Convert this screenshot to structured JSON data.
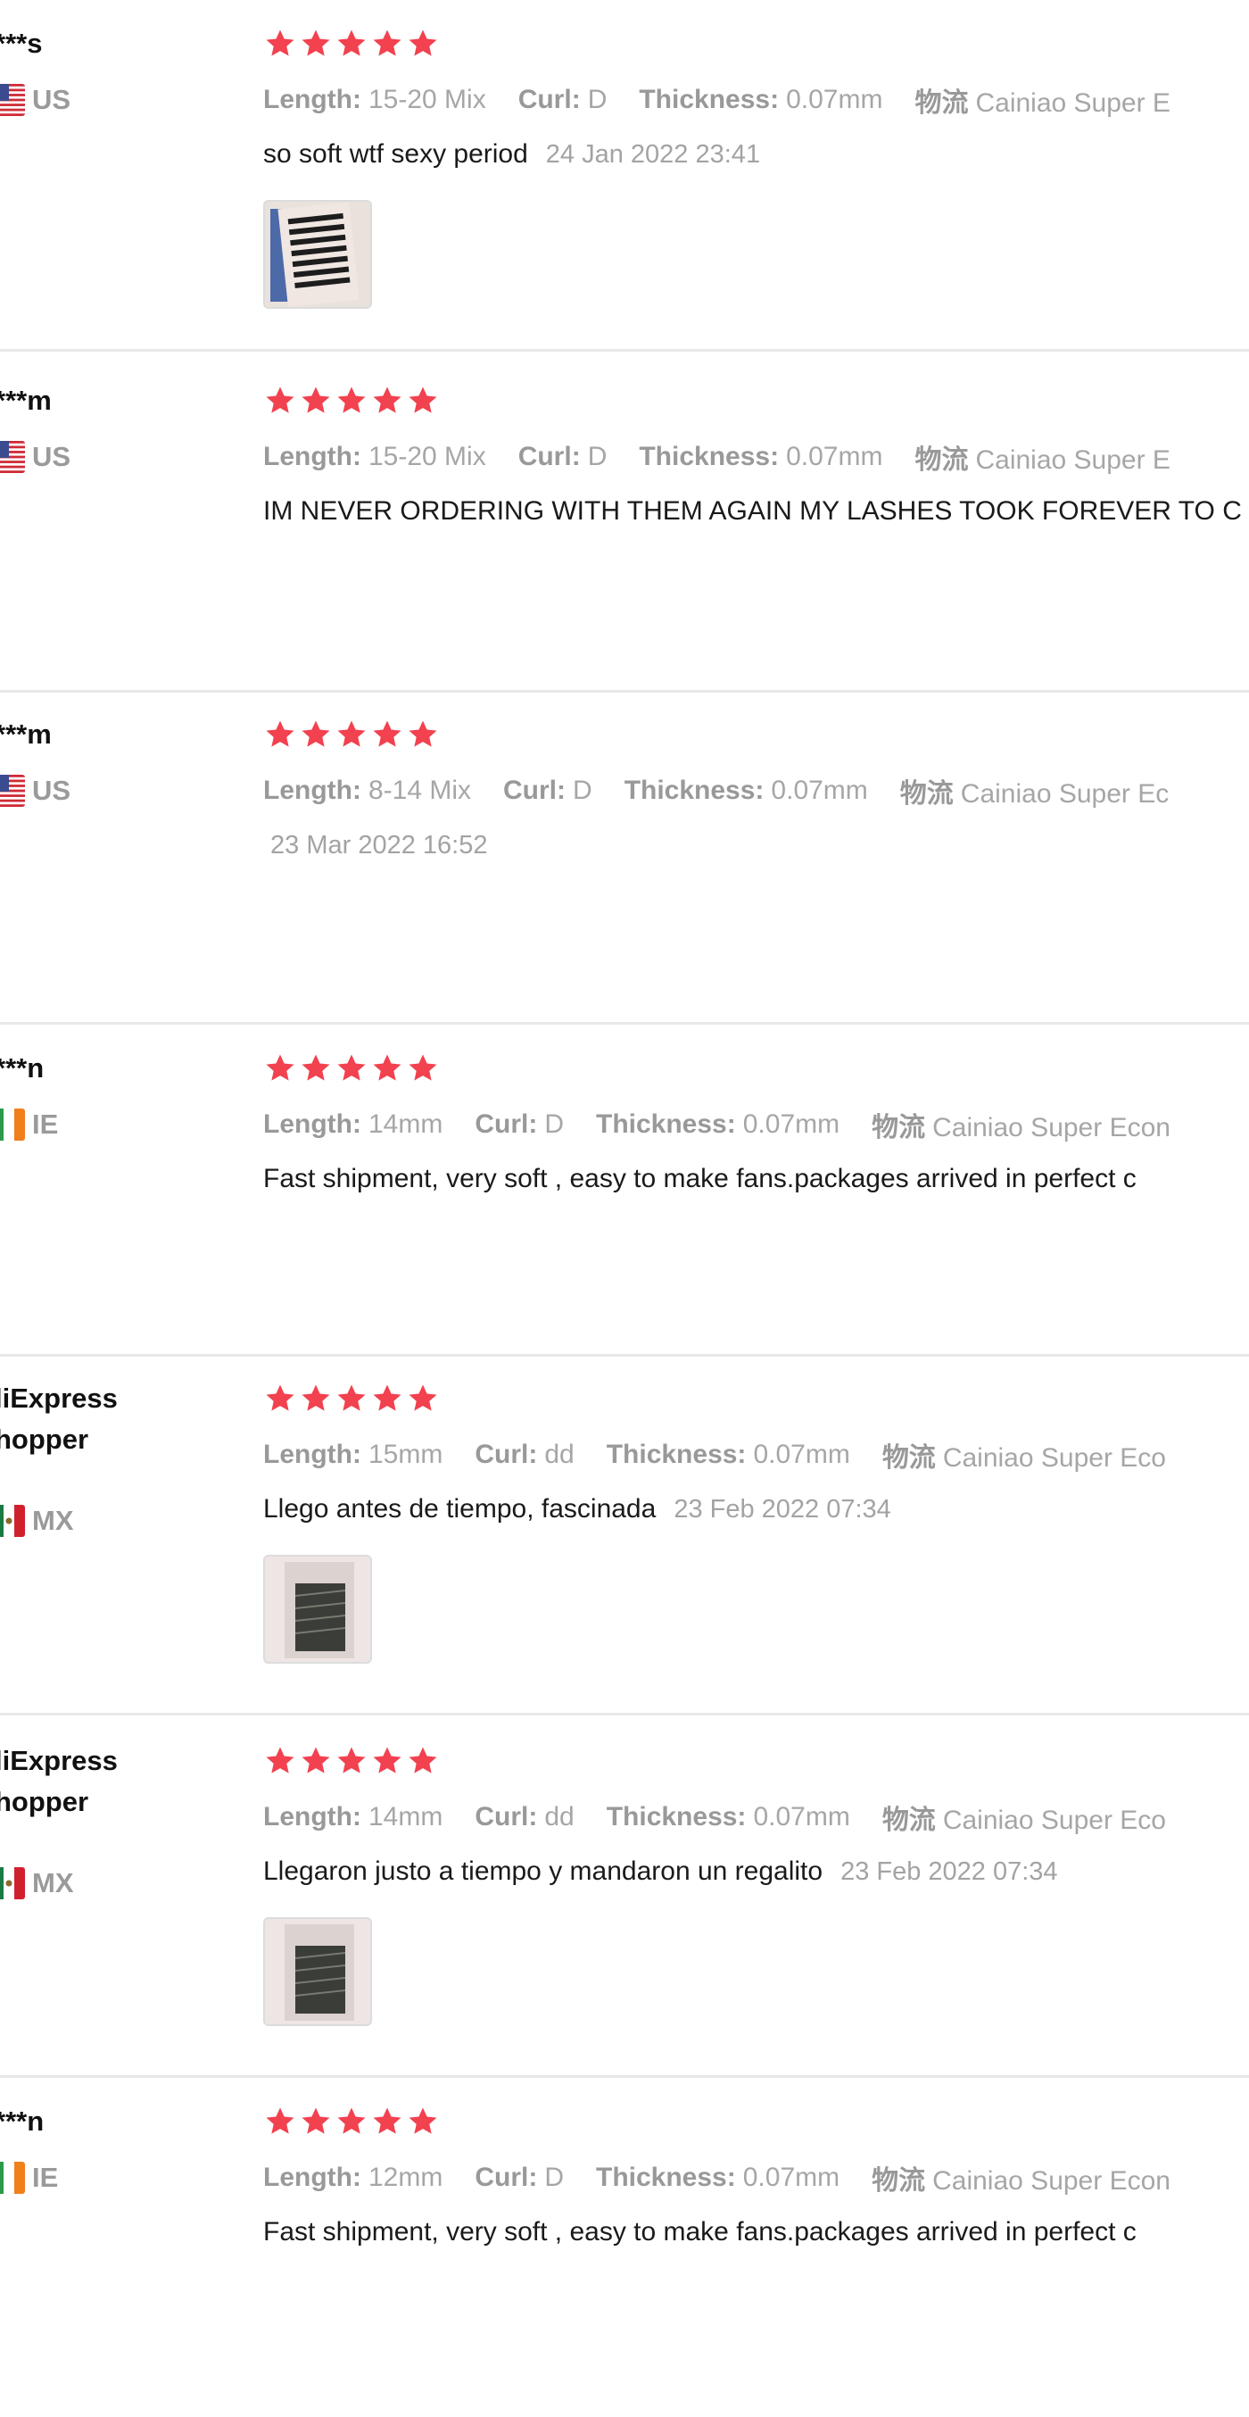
{
  "colors": {
    "star": "#f2414f",
    "attr_label": "#999999",
    "date": "#a3a3a3",
    "divider": "#e8e8e8",
    "text": "#1a1a1a"
  },
  "labels": {
    "length": "Length:",
    "curl": "Curl:",
    "thickness": "Thickness:",
    "shipping": "物流"
  },
  "reviews": [
    {
      "user": "***s",
      "country_code": "US",
      "flag": "us-flag-icon",
      "rating": 5,
      "length": "15-20 Mix",
      "curl": "D",
      "thickness": "0.07mm",
      "shipping": "Cainiao Super E",
      "comment": "so soft wtf sexy period",
      "date": "24 Jan 2022 23:41",
      "has_image": true
    },
    {
      "user": "***m",
      "country_code": "US",
      "flag": "us-flag-icon",
      "rating": 5,
      "length": "15-20 Mix",
      "curl": "D",
      "thickness": "0.07mm",
      "shipping": "Cainiao Super E",
      "comment": "IM NEVER ORDERING WITH THEM AGAIN MY LASHES TOOK FOREVER TO C",
      "date": "",
      "has_image": false
    },
    {
      "user": "***m",
      "country_code": "US",
      "flag": "us-flag-icon",
      "rating": 5,
      "length": "8-14 Mix",
      "curl": "D",
      "thickness": "0.07mm",
      "shipping": "Cainiao Super Ec",
      "comment": "",
      "date": "23 Mar 2022 16:52",
      "has_image": false
    },
    {
      "user": "***n",
      "country_code": "IE",
      "flag": "ie-flag-icon",
      "rating": 5,
      "length": "14mm",
      "curl": "D",
      "thickness": "0.07mm",
      "shipping": "Cainiao Super Econ",
      "comment": "Fast shipment, very soft , easy to make fans.packages arrived in perfect c",
      "date": "",
      "has_image": false
    },
    {
      "user": "liExpress\nhopper",
      "country_code": "MX",
      "flag": "mx-flag-icon",
      "rating": 5,
      "length": "15mm",
      "curl": "dd",
      "thickness": "0.07mm",
      "shipping": "Cainiao Super Eco",
      "comment": "Llego antes de tiempo, fascinada",
      "date": "23 Feb 2022 07:34",
      "has_image": true
    },
    {
      "user": "liExpress\nhopper",
      "country_code": "MX",
      "flag": "mx-flag-icon",
      "rating": 5,
      "length": "14mm",
      "curl": "dd",
      "thickness": "0.07mm",
      "shipping": "Cainiao Super Eco",
      "comment": "Llegaron justo a tiempo y mandaron un regalito",
      "date": "23 Feb 2022 07:34",
      "has_image": true
    },
    {
      "user": "***n",
      "country_code": "IE",
      "flag": "ie-flag-icon",
      "rating": 5,
      "length": "12mm",
      "curl": "D",
      "thickness": "0.07mm",
      "shipping": "Cainiao Super Econ",
      "comment": "Fast shipment, very soft , easy to make fans.packages arrived in perfect c",
      "date": "",
      "has_image": false
    }
  ]
}
